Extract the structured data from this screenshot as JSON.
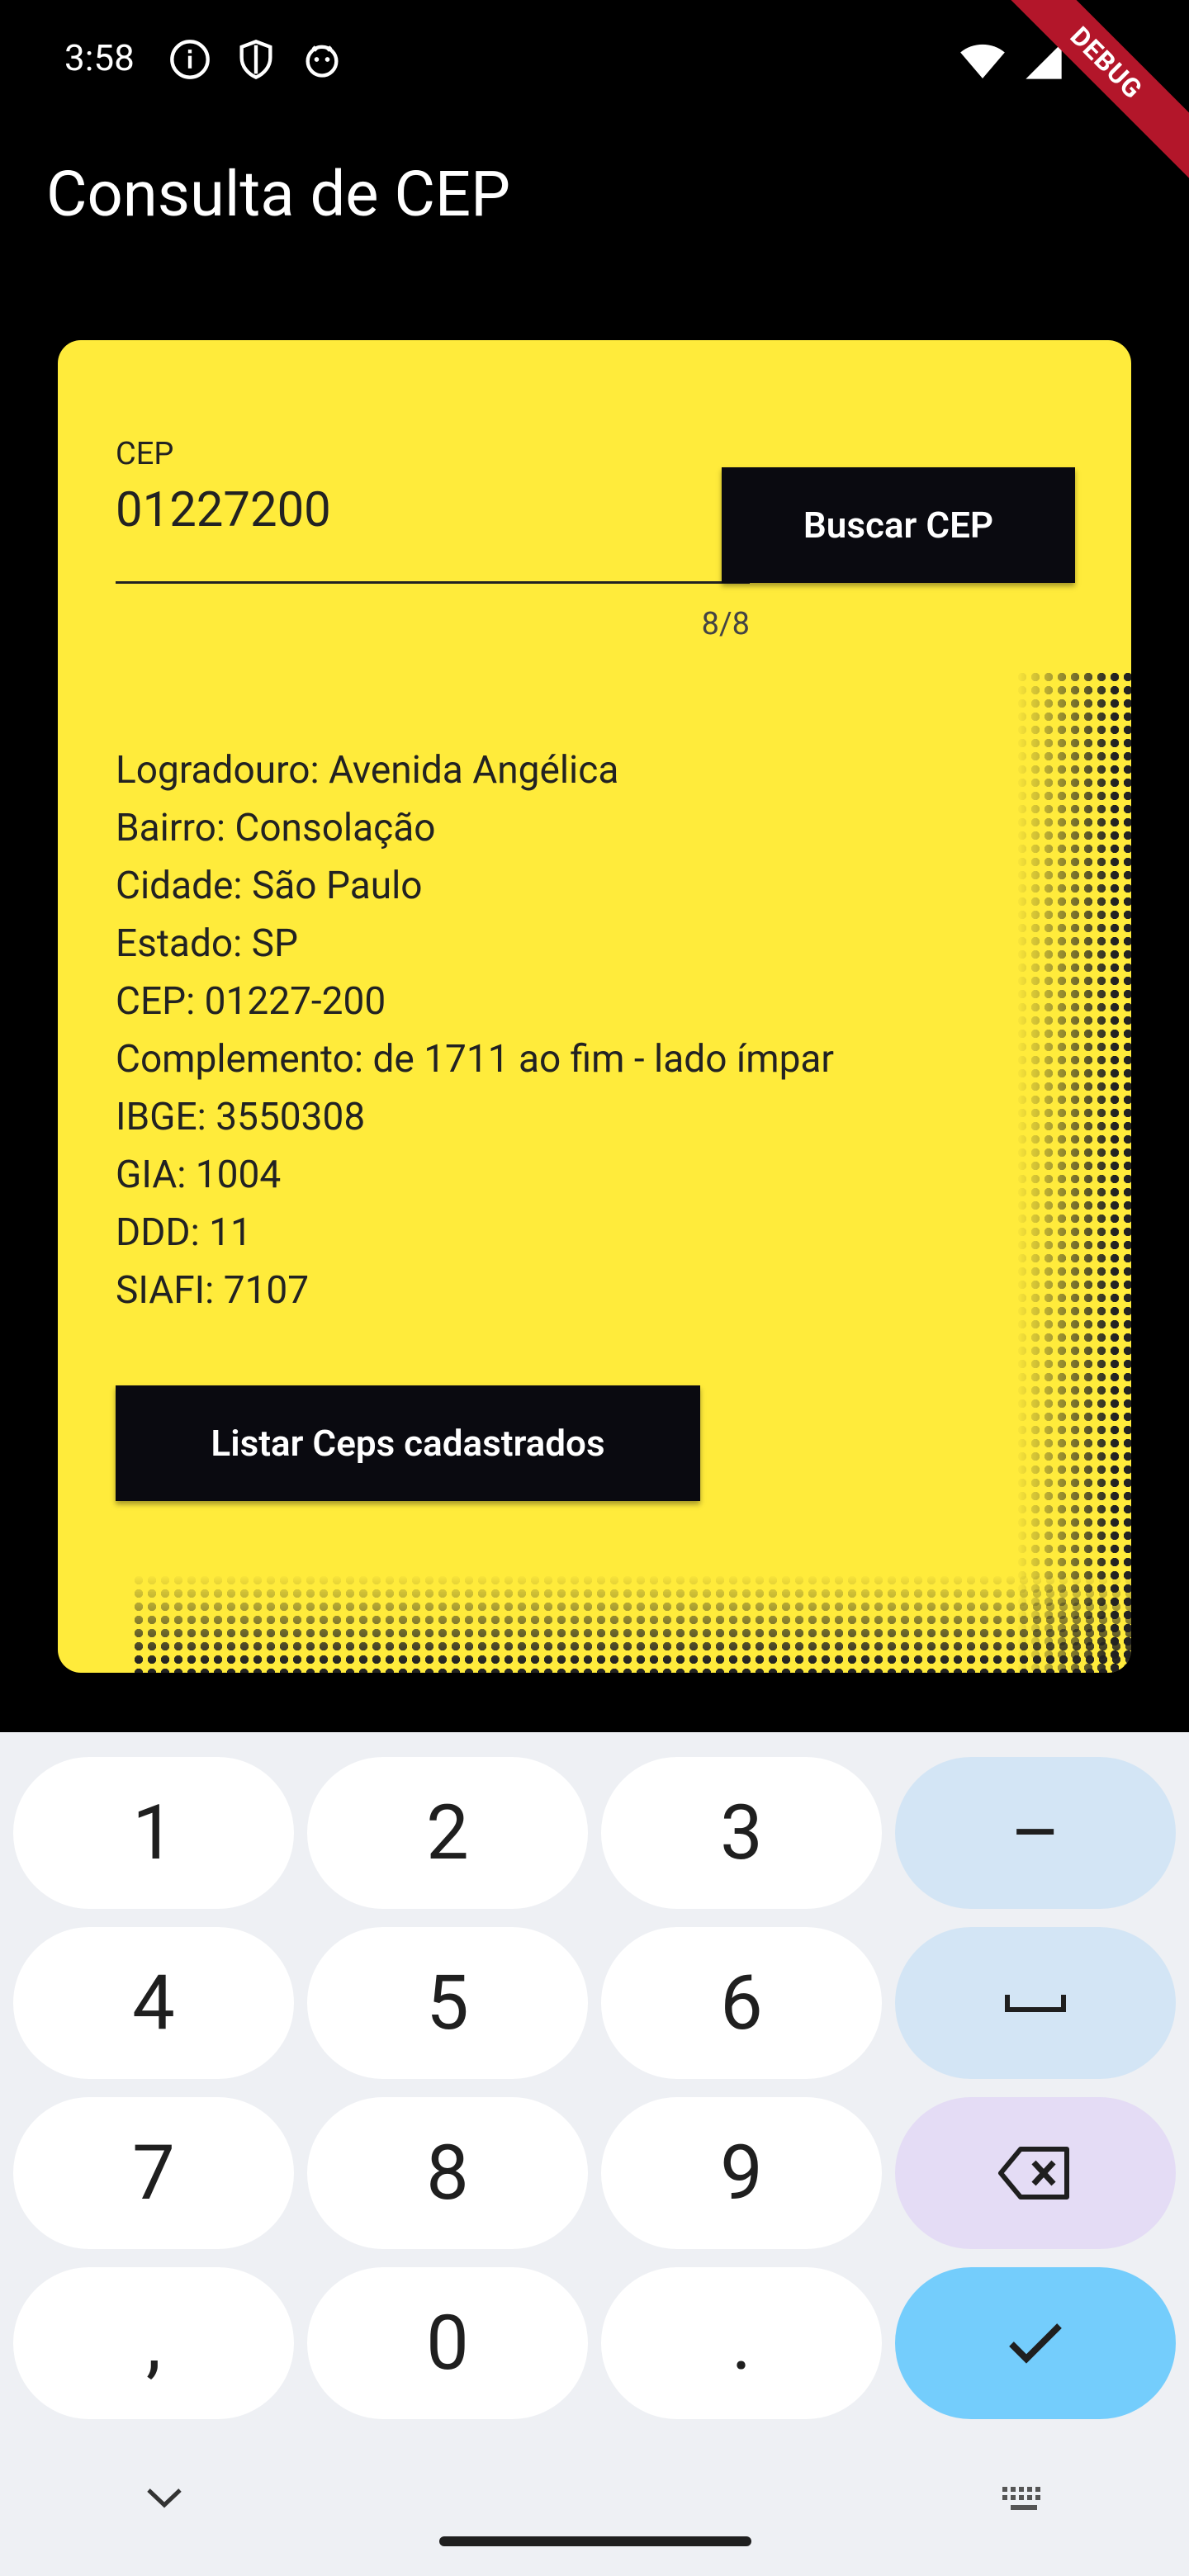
{
  "status_bar": {
    "time": "3:58",
    "debug_banner": "DEBUG"
  },
  "app_bar": {
    "title": "Consulta de CEP"
  },
  "form": {
    "cep_label": "CEP",
    "cep_value": "01227200",
    "counter": "8/8",
    "search_button": "Buscar CEP"
  },
  "result": {
    "logradouro": "Logradouro: Avenida Angélica",
    "bairro": "Bairro: Consolação",
    "cidade": "Cidade: São Paulo",
    "estado": "Estado: SP",
    "cep": "CEP: 01227-200",
    "complemento": "Complemento: de 1711 ao fim - lado ímpar",
    "ibge": "IBGE: 3550308",
    "gia": "GIA: 1004",
    "ddd": "DDD: 11",
    "siafi": "SIAFI: 7107"
  },
  "list_button": "Listar Ceps cadastrados",
  "keyboard": {
    "keys": [
      "1",
      "2",
      "3",
      "–",
      "4",
      "5",
      "6",
      "7",
      "8",
      "9",
      ",",
      "0",
      "."
    ]
  },
  "colors": {
    "card": "#FFEB3B",
    "button": "#0a0a10",
    "done_key": "#74cdfc"
  }
}
